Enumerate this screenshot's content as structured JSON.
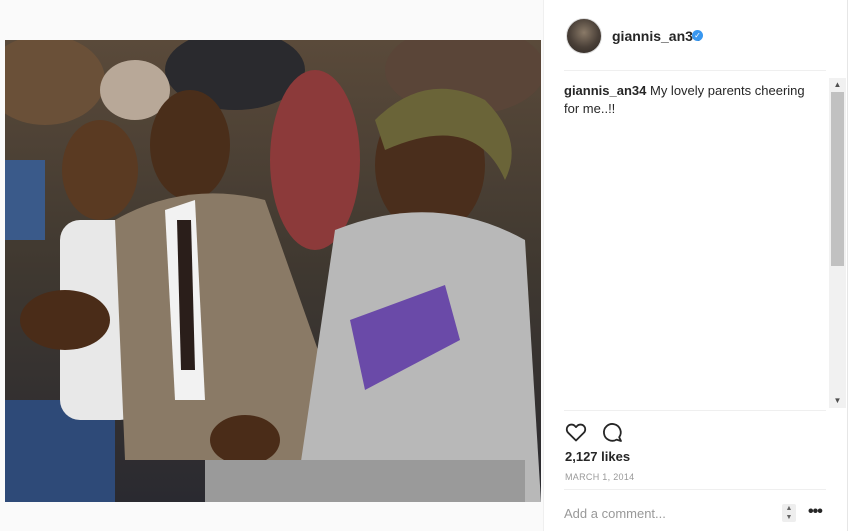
{
  "post": {
    "username": "giannis_an34",
    "verified_mark": "✓",
    "caption_user": "giannis_an34",
    "caption_text": " My lovely parents cheering for me..!!",
    "likes": "2,127 likes",
    "date": "MARCH 1, 2014",
    "comment_placeholder": "Add a comment...",
    "more_label": "•••"
  },
  "icons": {
    "heart": "heart-icon",
    "comment": "comment-icon",
    "verified": "verified-badge-icon"
  },
  "colors": {
    "text": "#262626",
    "muted": "#999999",
    "verified_blue": "#3897f0",
    "divider": "#efefef"
  }
}
